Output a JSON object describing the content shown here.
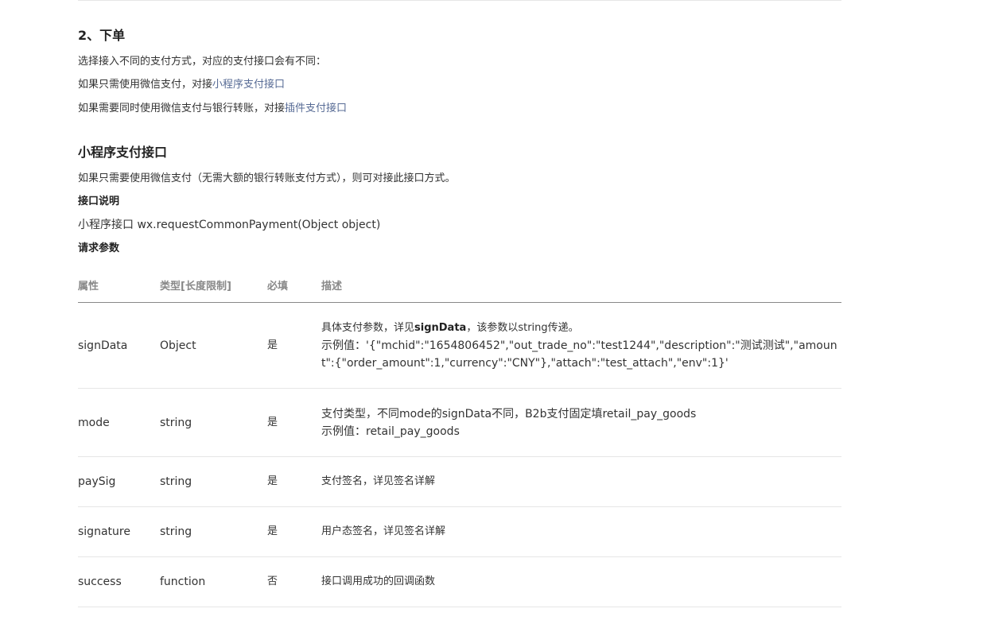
{
  "section_order": {
    "title": "2、下单",
    "intro": "选择接入不同的支付方式，对应的支付接口会有不同：",
    "line1_prefix": "如果只需使用微信支付，对接",
    "line1_link": "小程序支付接口",
    "line2_prefix": "如果需要同时使用微信支付与银行转账，对接",
    "line2_link": "插件支付接口"
  },
  "section_api": {
    "title": "小程序支付接口",
    "description": "如果只需要使用微信支付（无需大额的银行转账支付方式），则可对接此接口方式。",
    "api_heading": "接口说明",
    "api_signature": "小程序接口 wx.requestCommonPayment(Object object)",
    "params_heading": "请求参数"
  },
  "params_table": {
    "headers": [
      "属性",
      "类型[长度限制]",
      "必填",
      "描述"
    ],
    "rows": [
      {
        "name": "signData",
        "type": "Object",
        "required": "是",
        "desc_prefix": "具体支付参数，详见",
        "desc_strong": "signData",
        "desc_suffix": "，该参数以string传递。",
        "example_label": "示例值：",
        "example": "'{\"mchid\":\"1654806452\",\"out_trade_no\":\"test1244\",\"description\":\"测试测试\",\"amount\":{\"order_amount\":1,\"currency\":\"CNY\"},\"attach\":\"test_attach\",\"env\":1}'"
      },
      {
        "name": "mode",
        "type": "string",
        "required": "是",
        "desc": "支付类型，不同mode的signData不同，B2b支付固定填retail_pay_goods",
        "example_label": "示例值：",
        "example": "retail_pay_goods"
      },
      {
        "name": "paySig",
        "type": "string",
        "required": "是",
        "desc": "支付签名，详见签名详解"
      },
      {
        "name": "signature",
        "type": "string",
        "required": "是",
        "desc": "用户态签名，详见签名详解"
      },
      {
        "name": "success",
        "type": "function",
        "required": "否",
        "desc": "接口调用成功的回调函数"
      }
    ]
  },
  "colors": {
    "link": "#576b95",
    "text": "#333333",
    "header_text": "#888888",
    "row_border": "#e6e6e6"
  }
}
